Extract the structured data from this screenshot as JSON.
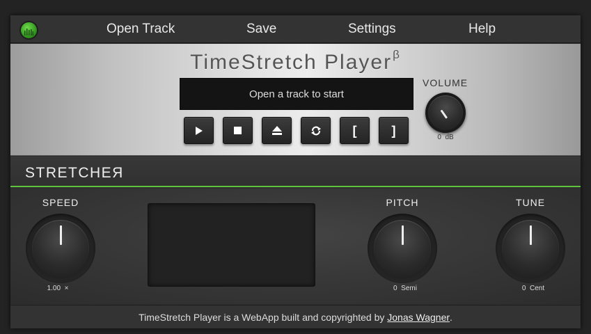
{
  "nav": {
    "logo_icon": "waveform-logo-icon",
    "items": [
      "Open Track",
      "Save",
      "Settings",
      "Help"
    ]
  },
  "player": {
    "title": "TimeStretch Player",
    "title_superscript": "β",
    "display_text": "Open a track to start",
    "buttons": [
      {
        "name": "play",
        "icon": "play-icon",
        "glyph": "▶"
      },
      {
        "name": "stop",
        "icon": "stop-icon",
        "glyph": "■"
      },
      {
        "name": "eject",
        "icon": "eject-icon",
        "glyph": "⏏"
      },
      {
        "name": "loop",
        "icon": "loop-icon",
        "glyph": "⟳"
      },
      {
        "name": "loop-start",
        "icon": "bracket-open-icon",
        "glyph": "["
      },
      {
        "name": "loop-end",
        "icon": "bracket-close-icon",
        "glyph": "]"
      }
    ],
    "volume": {
      "label": "VOLUME",
      "value": "0",
      "unit": "dB"
    }
  },
  "stretcher": {
    "title": "STRETCHEЯ",
    "speed": {
      "label": "SPEED",
      "value": "1.00",
      "unit": "×"
    },
    "pitch": {
      "label": "PITCH",
      "value": "0",
      "unit": "Semi"
    },
    "tune": {
      "label": "TUNE",
      "value": "0",
      "unit": "Cent"
    }
  },
  "footer": {
    "text": "TimeStretch Player is a WebApp built and copyrighted by ",
    "link": "Jonas Wagner",
    "suffix": "."
  },
  "colors": {
    "accent": "#5ec33f",
    "background": "#232323"
  }
}
